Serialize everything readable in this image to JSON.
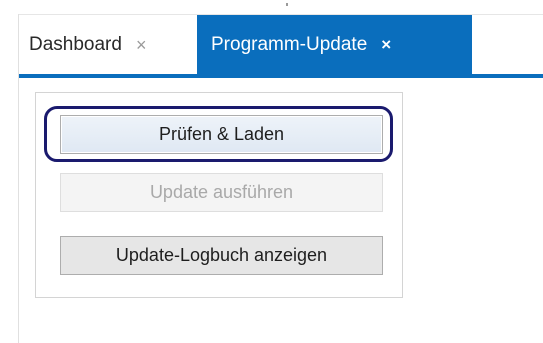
{
  "tabs": [
    {
      "label": "Dashboard",
      "close_glyph": "×",
      "active": false
    },
    {
      "label": "Programm-Update",
      "close_glyph": "×",
      "active": true
    }
  ],
  "panel": {
    "check_button_label": "Prüfen & Laden",
    "run_update_label": "Update ausführen",
    "run_update_enabled": false,
    "show_log_label": "Update-Logbuch anzeigen"
  },
  "colors": {
    "active_tab": "#0a6ebd",
    "focus_ring": "#1a1a6e",
    "disabled_text": "#a9a9a9"
  },
  "icons": {
    "tab_close": "close-icon"
  }
}
